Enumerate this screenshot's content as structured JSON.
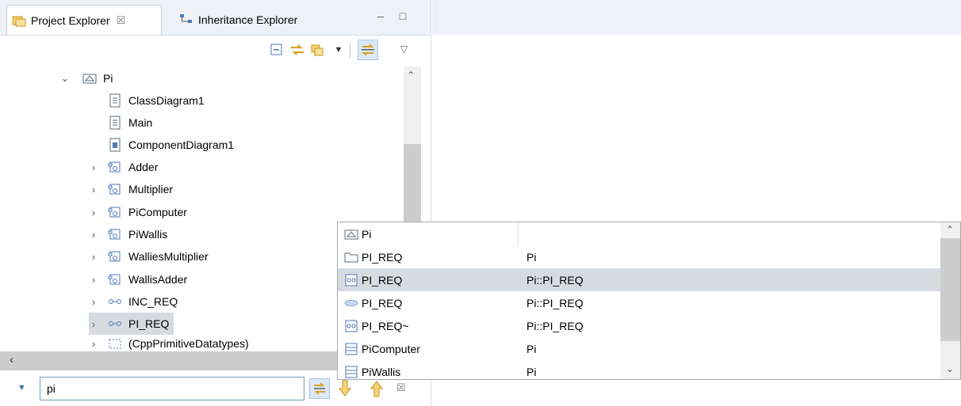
{
  "tabs": [
    {
      "label": "Project Explorer",
      "close": "☒"
    },
    {
      "label": "Inheritance Explorer"
    }
  ],
  "window_buttons": {
    "minimize": "–",
    "maximize": "□"
  },
  "tree": {
    "root": "Pi",
    "items": [
      {
        "label": "ClassDiagram1"
      },
      {
        "label": "Main"
      },
      {
        "label": "ComponentDiagram1"
      },
      {
        "label": "Adder"
      },
      {
        "label": "Multiplier"
      },
      {
        "label": "PiComputer"
      },
      {
        "label": "PiWallis"
      },
      {
        "label": "WalliesMultiplier"
      },
      {
        "label": "WallisAdder"
      },
      {
        "label": "INC_REQ"
      },
      {
        "label": "PI_REQ"
      },
      {
        "label": "(CppPrimitiveDatatypes)"
      }
    ]
  },
  "filter": {
    "value": "pi",
    "clear": "☒"
  },
  "popup": {
    "rows": [
      {
        "name": "Pi",
        "qualifier": ""
      },
      {
        "name": "PI_REQ",
        "qualifier": "Pi"
      },
      {
        "name": "PI_REQ",
        "qualifier": "Pi::PI_REQ"
      },
      {
        "name": "PI_REQ",
        "qualifier": "Pi::PI_REQ"
      },
      {
        "name": "PI_REQ~",
        "qualifier": "Pi::PI_REQ"
      },
      {
        "name": "PiComputer",
        "qualifier": "Pi"
      },
      {
        "name": "PiWallis",
        "qualifier": "Pi"
      }
    ]
  },
  "colors": {
    "selection": "#d7dbe0",
    "folder": "#d9a520",
    "link": "#4a7ab8"
  }
}
